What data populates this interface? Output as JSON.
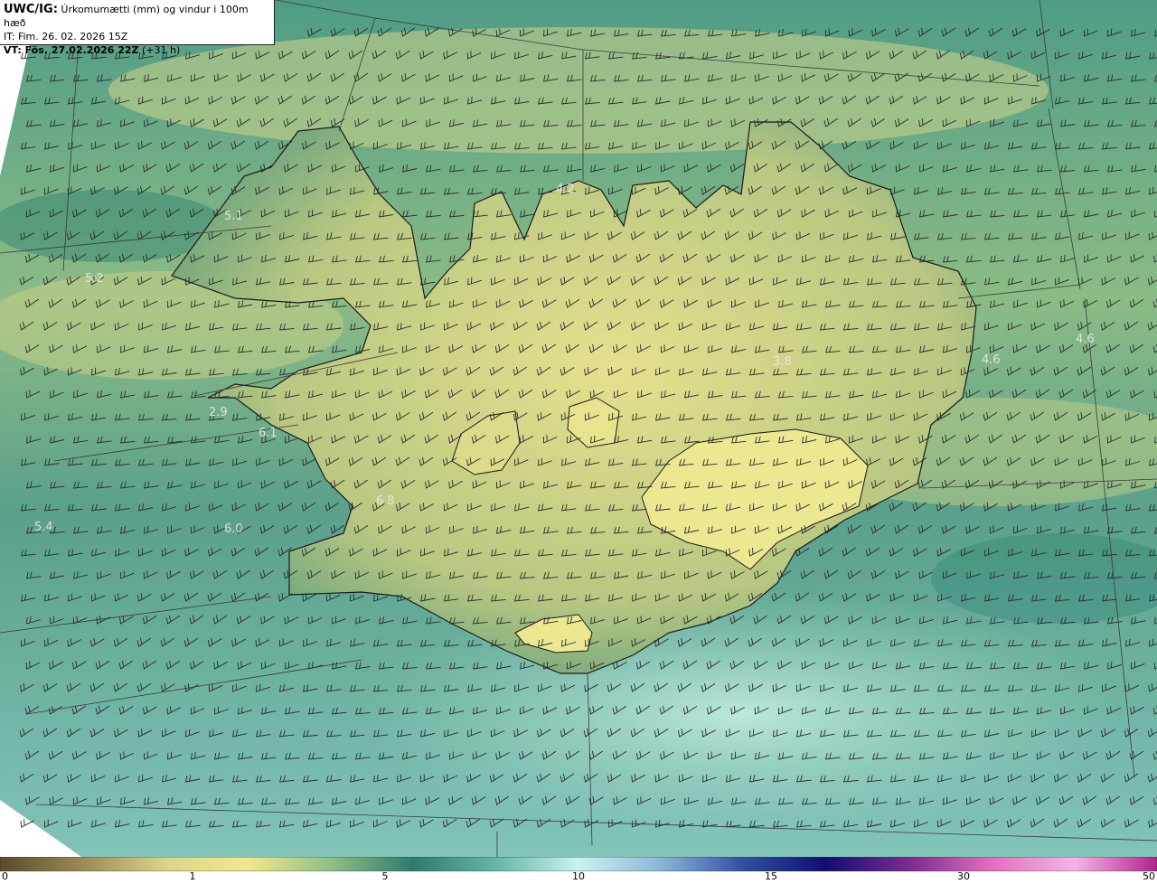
{
  "header": {
    "model": "UWC/IG:",
    "title": "Úrkomumætti (mm) og vindur i 100m hæð",
    "init_time": "IT: Fim. 26. 02. 2026 15Z",
    "valid_time": "VT: Fös. 27.02.2026 22Z",
    "lead_time": "(+31 h)"
  },
  "map_labels": [
    {
      "text": "5.1"
    },
    {
      "text": "5.2"
    },
    {
      "text": "4.2"
    },
    {
      "text": "3.8"
    },
    {
      "text": "4.6"
    },
    {
      "text": "4.6"
    },
    {
      "text": "2.9"
    },
    {
      "text": "6.1"
    },
    {
      "text": "6.8"
    },
    {
      "text": "5.4"
    },
    {
      "text": "6.0"
    }
  ],
  "colorbar": {
    "ticks": [
      "0",
      "1",
      "5",
      "10",
      "15",
      "30",
      "50"
    ],
    "colors": [
      "#5b4a2c",
      "#9b8a55",
      "#d9d58a",
      "#f0e88e",
      "#8fbf85",
      "#2e7b6c",
      "#66b7a8",
      "#c9f3ef",
      "#8cb6d8",
      "#2f4fa0",
      "#101070",
      "#7b2b8f",
      "#e070c0",
      "#f2b6e6",
      "#b0238f"
    ]
  }
}
